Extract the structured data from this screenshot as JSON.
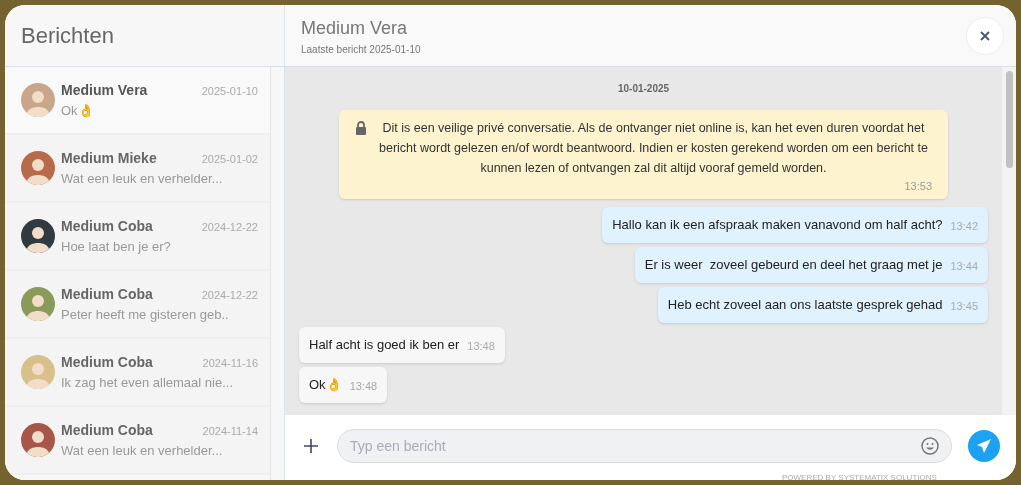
{
  "sidebar": {
    "title": "Berichten",
    "conversations": [
      {
        "name": "Medium Vera",
        "date": "2025-01-10",
        "preview": "Ok👌",
        "selected": true
      },
      {
        "name": "Medium Mieke",
        "date": "2025-01-02",
        "preview": "Wat een leuk en verhelder...",
        "selected": false
      },
      {
        "name": "Medium Coba",
        "date": "2024-12-22",
        "preview": "Hoe laat ben je er?",
        "selected": false
      },
      {
        "name": "Medium Coba",
        "date": "2024-12-22",
        "preview": "Peter heeft me gisteren geb..",
        "selected": false
      },
      {
        "name": "Medium Coba",
        "date": "2024-11-16",
        "preview": "Ik zag het even allemaal nie...",
        "selected": false
      },
      {
        "name": "Medium Coba",
        "date": "2024-11-14",
        "preview": "Wat een leuk en verhelder...",
        "selected": false
      }
    ]
  },
  "chat": {
    "title": "Medium Vera",
    "subtitle": "Laatste bericht 2025-01-10",
    "day": "10-01-2025",
    "messages": [
      {
        "kind": "notice",
        "text": "Dit is een veilige privé conversatie. Als de ontvanger niet online is, kan het even duren voordat het bericht wordt gelezen en/of wordt beantwoord. Indien er kosten gerekend worden om een bericht te kunnen lezen of ontvangen zal dit altijd vooraf gemeld worden.",
        "time": "13:53"
      },
      {
        "kind": "outgoing",
        "text": "Hallo kan ik een afspraak maken vanavond om half acht?",
        "time": "13:42"
      },
      {
        "kind": "outgoing",
        "text": "Er is weer  zoveel gebeurd en deel het graag met je",
        "time": "13:44"
      },
      {
        "kind": "outgoing",
        "text": "Heb echt zoveel aan ons laatste gesprek gehad",
        "time": "13:45"
      },
      {
        "kind": "incoming",
        "text": "Half acht is goed ik ben er",
        "time": "13:48"
      },
      {
        "kind": "incoming",
        "text": "Ok👌",
        "time": "13:48"
      }
    ]
  },
  "composer": {
    "placeholder": "Typ een bericht",
    "footer": "POWERED BY SYSTEMATIX SOLUTIONS"
  }
}
